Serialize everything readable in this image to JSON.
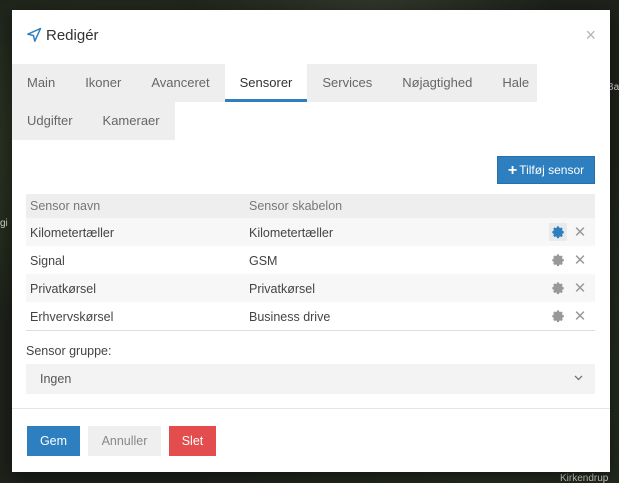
{
  "dialog": {
    "title": "Redigér",
    "close_symbol": "×",
    "icon": "location-arrow-icon"
  },
  "tabs": {
    "row1": [
      {
        "label": "Main",
        "active": false
      },
      {
        "label": "Ikoner",
        "active": false
      },
      {
        "label": "Avanceret",
        "active": false
      },
      {
        "label": "Sensorer",
        "active": true
      },
      {
        "label": "Services",
        "active": false
      },
      {
        "label": "Nøjagtighed",
        "active": false
      },
      {
        "label": "Hale",
        "active": false
      }
    ],
    "row2": [
      {
        "label": "Udgifter",
        "active": false
      },
      {
        "label": "Kameraer",
        "active": false
      }
    ]
  },
  "add_sensor_button": {
    "icon": "plus-icon",
    "label": "Tilføj sensor"
  },
  "sensor_table": {
    "columns": [
      "Sensor navn",
      "Sensor skabelon"
    ],
    "rows": [
      {
        "name": "Kilometertæller",
        "template": "Kilometertæller",
        "gear_highlighted": true
      },
      {
        "name": "Signal",
        "template": "GSM",
        "gear_highlighted": false
      },
      {
        "name": "Privatkørsel",
        "template": "Privatkørsel",
        "gear_highlighted": false
      },
      {
        "name": "Erhvervskørsel",
        "template": "Business drive",
        "gear_highlighted": false
      }
    ],
    "row_icons": [
      "gear-icon",
      "close-icon"
    ]
  },
  "sensor_group": {
    "label": "Sensor gruppe:",
    "value": "Ingen",
    "chevron": "⌄"
  },
  "footer": {
    "save": "Gem",
    "cancel": "Annuller",
    "delete": "Slet"
  },
  "colors": {
    "primary": "#2d7fc0",
    "danger": "#e44d4d",
    "tab_bg": "#eeeeee"
  },
  "map_labels": [
    "Ba",
    "gi",
    "Kirkendrup"
  ]
}
